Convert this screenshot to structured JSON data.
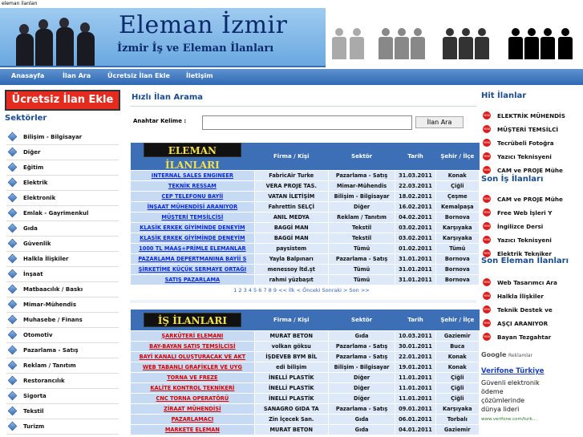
{
  "page": {
    "top_label": "eleman ilanları"
  },
  "header": {
    "title": "Eleman İzmir",
    "subtitle": "İzmir İş ve Eleman İlanları"
  },
  "nav": {
    "items": [
      "Anasayfa",
      "İlan Ara",
      "Ücretsiz İlan Ekle",
      "İletişim"
    ]
  },
  "promo": {
    "label": "Ücretsiz İlan Ekle"
  },
  "sectors": {
    "title": "Sektörler",
    "items": [
      "Bilişim - Bilgisayar",
      "Diğer",
      "Eğitim",
      "Elektrik",
      "Elektronik",
      "Emlak - Gayrimenkul",
      "Gıda",
      "Güvenlik",
      "Halkla İlişkiler",
      "İnşaat",
      "Matbaacılık / Baskı",
      "Mimar-Mühendis",
      "Muhasebe / Finans",
      "Otomotiv",
      "Pazarlama - Satış",
      "Reklam / Tanıtım",
      "Restorancılık",
      "Sigorta",
      "Tekstil",
      "Turizm"
    ]
  },
  "search": {
    "title": "Hızlı İlan Arama",
    "label": "Anahtar Kelime :",
    "value": "",
    "button": "İlan Ara"
  },
  "table1": {
    "banner": "ELEMAN İLANLARI",
    "headers": [
      "Firma / Kişi",
      "Sektör",
      "Tarih",
      "Şehir / İlçe"
    ],
    "rows": [
      [
        "INTERNAL SALES ENGINEER",
        "FabricAir Turke",
        "Pazarlama - Satış",
        "31.03.2011",
        "Konak"
      ],
      [
        "TEKNİK RESSAM",
        "VERA PROJE TAS.",
        "Mimar-Mühendis",
        "22.03.2011",
        "Çiğli"
      ],
      [
        "CEP TELEFONU BAYİİ",
        "VATAN İLETİŞİM",
        "Bilişim - Bilgisayar",
        "18.02.2011",
        "Çeşme"
      ],
      [
        "İNŞAAT MÜHENDİSİ ARANIYOR",
        "Fahrettin SELÇİ",
        "Diğer",
        "16.02.2011",
        "Kemalpaşa"
      ],
      [
        "MÜŞTERİ TEMSİLCİSİ",
        "ANIL MEDYA",
        "Reklam / Tanıtım",
        "04.02.2011",
        "Bornova"
      ],
      [
        "KLASİK ERKEK GİYİMİNDE DENEYİM",
        "BAGGİ MAN",
        "Tekstil",
        "03.02.2011",
        "Karşıyaka"
      ],
      [
        "KLASİK ERKEK GİYİMİNDE DENEYİM",
        "BAGGİ MAN",
        "Tekstil",
        "03.02.2011",
        "Karşıyaka"
      ],
      [
        "1000 TL MAAŞ+PRİMLE ELEMANLAR",
        "paysistem",
        "Tümü",
        "01.02.2011",
        "Tümü"
      ],
      [
        "PAZARLAMA DEPERTMANINA BAYİİ S",
        "Yayla Balpınarı",
        "Pazarlama - Satış",
        "31.01.2011",
        "Bornova"
      ],
      [
        "ŞİRKETİME KÜÇÜK SERMAYE ORTAĞI",
        "menessoy ltd.şt",
        "Tümü",
        "31.01.2011",
        "Bornova"
      ],
      [
        "SATIŞ PAZARLAMA",
        "rahmi yüzbaşıt",
        "Tümü",
        "31.01.2011",
        "Bornova"
      ]
    ],
    "pager": "1 2 3 4 5 6 7 8 9  <<  İlk < Önceki Sonraki > Son >>"
  },
  "table2": {
    "banner": "İŞ İLANLARI",
    "headers": [
      "Firma / Kişi",
      "Sektör",
      "Tarih",
      "Şehir / İlçe"
    ],
    "rows": [
      [
        "ŞARKÜTERİ ELEMANI",
        "MURAT BETON",
        "Gıda",
        "10.03.2011",
        "Gaziemir"
      ],
      [
        "BAY-BAYAN SATIŞ TEMSİLCİSİ",
        "volkan göksu",
        "Pazarlama - Satış",
        "30.01.2011",
        "Buca"
      ],
      [
        "BAYİ KANALI OLUŞTURACAK VE AKT",
        "İŞDEVEB BYM BİL",
        "Pazarlama - Satış",
        "22.01.2011",
        "Konak"
      ],
      [
        "WEB TABANLI GRAFİKLER VE UYG",
        "edi bilişim",
        "Bilişim - Bilgisayar",
        "19.01.2011",
        "Konak"
      ],
      [
        "TORNA VE FREZE",
        "İNELLİ PLASTİK",
        "Diğer",
        "11.01.2011",
        "Çiğli"
      ],
      [
        "KALİTE KONTROL TEKNİKERİ",
        "İNELLİ PLASTİK",
        "Diğer",
        "11.01.2011",
        "Çiğli"
      ],
      [
        "CNC TORNA OPERATÖRÜ",
        "İNELLİ PLASTİK",
        "Diğer",
        "11.01.2011",
        "Çiğli"
      ],
      [
        "ZİRAAT MÜHENDİSİ",
        "SANAGRO GIDA TA",
        "Pazarlama - Satış",
        "09.01.2011",
        "Karşıyaka"
      ],
      [
        "PAZARLAMACI",
        "Zin İçecek San.",
        "Gıda",
        "06.01.2011",
        "Torbalı"
      ],
      [
        "MARKETE ELEMAN",
        "MURAT BETON",
        "Gıda",
        "04.01.2011",
        "Gaziemir"
      ]
    ]
  },
  "hit": {
    "title": "Hit İlanlar",
    "items": [
      "ELEKTRİK MÜHENDİS",
      "MÜŞTERİ TEMSİLCİ",
      "Tecrübeli Fotoğra",
      "Yazıcı Teknisyeni",
      "CAM ve PROJE Mühe"
    ]
  },
  "latest": {
    "title": "Son  İş İlanları",
    "items": [
      "CAM ve PROJE Mühe",
      "Free Web İşleri Y",
      "İngilizce Dersi",
      "Yazıcı Teknisyeni",
      "Elektrik Tekniker"
    ]
  },
  "latest_emp": {
    "title": "Son  Eleman İlanları",
    "items": [
      "Web Tasarımcı Ara",
      "Halkla İlişkiler",
      "Teknik Destek ve",
      "AŞÇI ARANIYOR",
      "Bayan Tezgahtar"
    ]
  },
  "ads": {
    "google_label": "Google",
    "reklam": "Reklamlar",
    "title": "Verifone Türkiye",
    "body": "Güvenli elektronik ödeme çözümlerinde dünya lideri",
    "url": "www.verifone.com/turk..."
  },
  "tag_text": "YENİ"
}
